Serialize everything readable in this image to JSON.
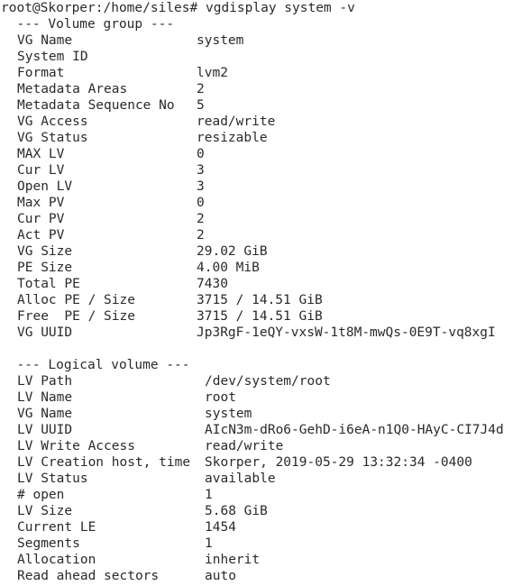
{
  "prompt": "root@Skorper:/home/siles#",
  "command": "vgdisplay system -v",
  "vg_header": "  --- Volume group ---",
  "vg_rows": [
    {
      "key": "VG Name",
      "value": "system"
    },
    {
      "key": "System ID",
      "value": ""
    },
    {
      "key": "Format",
      "value": "lvm2"
    },
    {
      "key": "Metadata Areas",
      "value": "2"
    },
    {
      "key": "Metadata Sequence No",
      "value": "5"
    },
    {
      "key": "VG Access",
      "value": "read/write"
    },
    {
      "key": "VG Status",
      "value": "resizable"
    },
    {
      "key": "MAX LV",
      "value": "0"
    },
    {
      "key": "Cur LV",
      "value": "3"
    },
    {
      "key": "Open LV",
      "value": "3"
    },
    {
      "key": "Max PV",
      "value": "0"
    },
    {
      "key": "Cur PV",
      "value": "2"
    },
    {
      "key": "Act PV",
      "value": "2"
    },
    {
      "key": "VG Size",
      "value": "29.02 GiB"
    },
    {
      "key": "PE Size",
      "value": "4.00 MiB"
    },
    {
      "key": "Total PE",
      "value": "7430"
    },
    {
      "key": "Alloc PE / Size",
      "value": "3715 / 14.51 GiB"
    },
    {
      "key": "Free  PE / Size",
      "value": "3715 / 14.51 GiB"
    },
    {
      "key": "VG UUID",
      "value": "Jp3RgF-1eQY-vxsW-1t8M-mwQs-0E9T-vq8xgI"
    }
  ],
  "lv_header": "  --- Logical volume ---",
  "lv_rows": [
    {
      "key": "LV Path",
      "value": "/dev/system/root"
    },
    {
      "key": "LV Name",
      "value": "root"
    },
    {
      "key": "VG Name",
      "value": "system"
    },
    {
      "key": "LV UUID",
      "value": "AIcN3m-dRo6-GehD-i6eA-n1Q0-HAyC-CI7J4d"
    },
    {
      "key": "LV Write Access",
      "value": "read/write"
    },
    {
      "key": "LV Creation host, time",
      "value": "Skorper, 2019-05-29 13:32:34 -0400"
    },
    {
      "key": "LV Status",
      "value": "available"
    },
    {
      "key": "# open",
      "value": "1"
    },
    {
      "key": "LV Size",
      "value": "5.68 GiB"
    },
    {
      "key": "Current LE",
      "value": "1454"
    },
    {
      "key": "Segments",
      "value": "1"
    },
    {
      "key": "Allocation",
      "value": "inherit"
    },
    {
      "key": "Read ahead sectors",
      "value": "auto"
    }
  ]
}
